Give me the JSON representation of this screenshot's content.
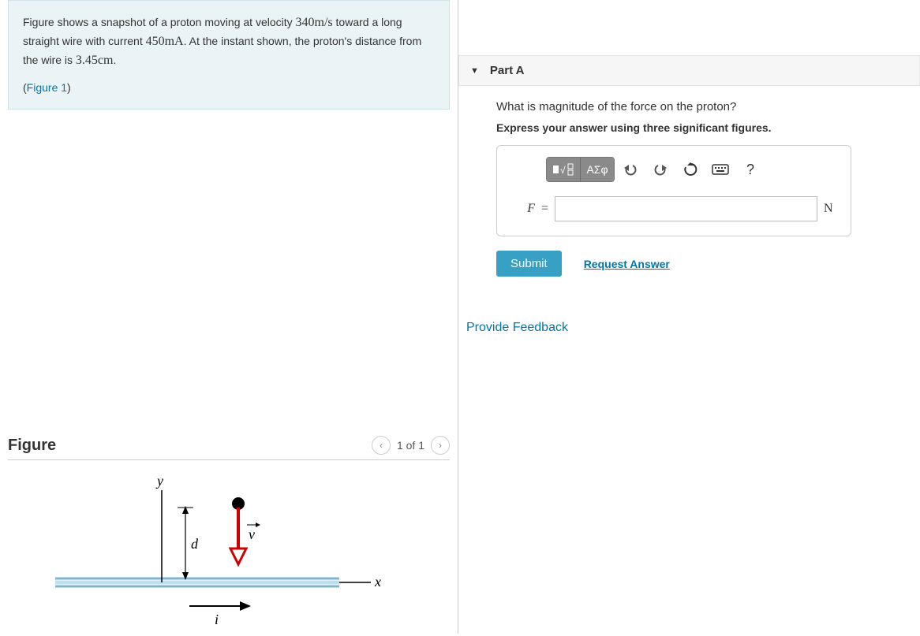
{
  "problem": {
    "text_pre": "Figure shows a snapshot of a proton moving at velocity ",
    "velocity": "340",
    "velocity_unit": "m/s",
    "text_mid1": " toward a long straight wire with current ",
    "current": "450",
    "current_unit": "mA",
    "text_mid2": ". At the instant shown, the proton's distance from the wire is ",
    "distance": "3.45",
    "distance_unit": "cm",
    "text_end": ".",
    "figure_link": "Figure 1"
  },
  "figure": {
    "title": "Figure",
    "counter": "1 of 1",
    "labels": {
      "y": "y",
      "x": "x",
      "d": "d",
      "v": "v",
      "i": "i"
    }
  },
  "partA": {
    "title": "Part A",
    "question": "What is magnitude of the force on the proton?",
    "instruction": "Express your answer using three significant figures.",
    "toolbar": {
      "tmpl": "∎√[]",
      "greek": "ΑΣφ",
      "undo": "undo",
      "redo": "redo",
      "reset": "reset",
      "keyboard": "keyboard",
      "help": "?"
    },
    "variable": "F",
    "equals": "=",
    "unit": "N",
    "submit": "Submit",
    "request": "Request Answer"
  },
  "feedback": "Provide Feedback"
}
